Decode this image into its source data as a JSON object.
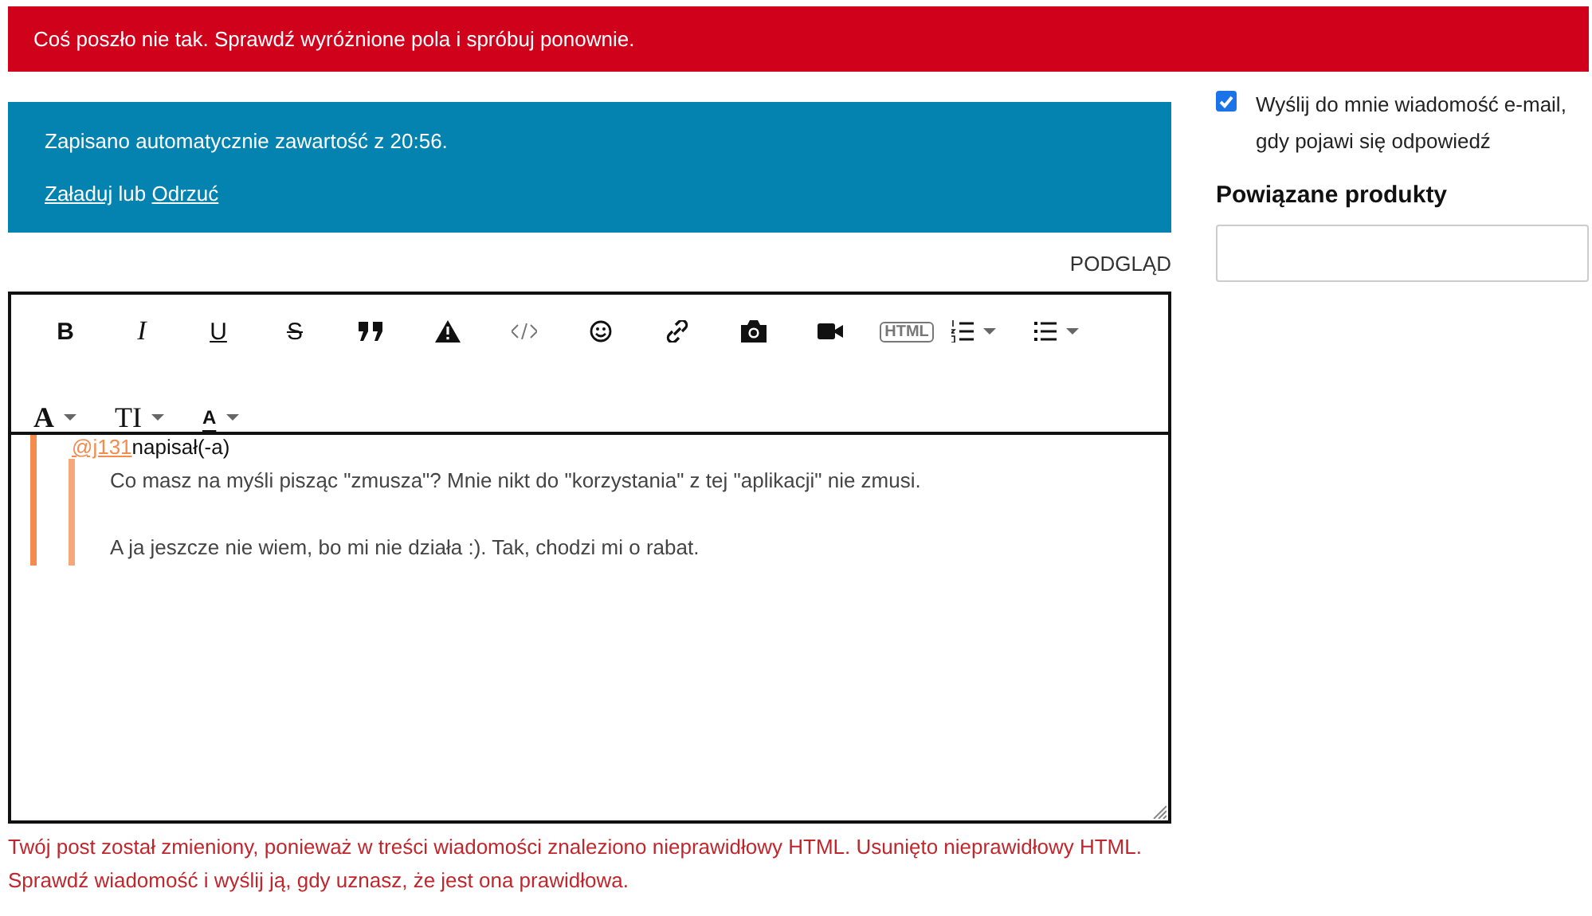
{
  "error_banner": "Coś poszło nie tak. Sprawdź wyróżnione pola i spróbuj ponownie.",
  "autosave": {
    "message": "Zapisano automatycznie zawartość z 20:56.",
    "load_link": "Załaduj",
    "separator": "lub",
    "discard_link": "Odrzuć"
  },
  "preview_link": "PODGLĄD",
  "toolbar": [
    {
      "kind": "text",
      "label": "B",
      "dropdown": false
    },
    {
      "kind": "text",
      "label": "I",
      "dropdown": false
    },
    {
      "kind": "text",
      "label": "U",
      "dropdown": false
    },
    {
      "kind": "text",
      "label": "S",
      "dropdown": false
    },
    {
      "kind": "icon",
      "dropdown": false
    },
    {
      "kind": "icon",
      "dropdown": false
    },
    {
      "kind": "icon",
      "dropdown": false
    },
    {
      "kind": "icon",
      "dropdown": false
    },
    {
      "kind": "icon",
      "dropdown": false
    },
    {
      "kind": "icon",
      "dropdown": false
    },
    {
      "kind": "icon",
      "dropdown": false
    },
    {
      "kind": "text",
      "label": "HTML",
      "dropdown": false
    },
    {
      "kind": "icon",
      "dropdown": true
    },
    {
      "kind": "icon",
      "dropdown": true
    },
    {
      "kind": "text",
      "label": "A",
      "dropdown": true
    },
    {
      "kind": "text",
      "label": "TI",
      "dropdown": true
    },
    {
      "kind": "text",
      "label": "A",
      "dropdown": true
    }
  ],
  "quote": {
    "author": "@j131",
    "wrote": "napisał(-a)",
    "paragraphs": [
      "Co masz na myśli pisząc \"zmusza\"? Mnie nikt do \"korzystania\" z tej \"aplikacji\" nie zmusi.",
      "A ja jeszcze nie wiem, bo mi nie działa :). Tak, chodzi mi o rabat."
    ]
  },
  "validation_message": [
    "Twój post został zmieniony, ponieważ w treści wiadomości znaleziono nieprawidłowy HTML. Usunięto nieprawidłowy HTML.",
    "Sprawdź wiadomość i wyślij ją, gdy uznasz, że jest ona prawidłowa."
  ],
  "email_notify": {
    "label": "Wyślij do mnie wiadomość e-mail, gdy pojawi się odpowiedź",
    "checked": true
  },
  "related_products": {
    "title": "Powiązane produkty"
  }
}
